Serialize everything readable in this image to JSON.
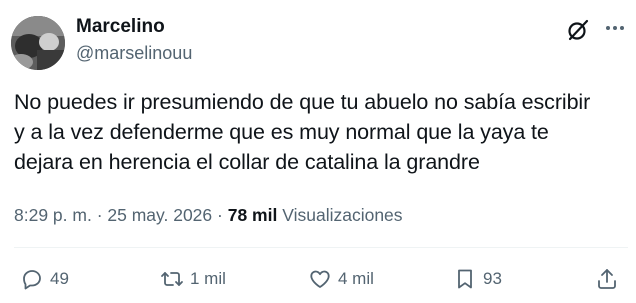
{
  "author": {
    "name": "Marcelino",
    "handle": "@marselinouu"
  },
  "tweet": {
    "lines": [
      "No puedes ir presumiendo de que tu abuelo no sabía escribir",
      "y a la vez defenderme que es muy normal que la yaya te",
      "dejara en herencia el collar de catalina la grandre"
    ]
  },
  "meta": {
    "time": "8:29 p. m.",
    "separator": "·",
    "date": "25 may. 2026",
    "views_count": "78 mil",
    "views_label": "Visualizaciones"
  },
  "actions": {
    "replies": "49",
    "reposts": "1 mil",
    "likes": "4 mil",
    "bookmarks": "93"
  },
  "icons": {
    "grok": "grok-icon",
    "more": "more-options-icon",
    "reply": "reply-icon",
    "repost": "repost-icon",
    "like": "heart-icon",
    "bookmark": "bookmark-icon",
    "share": "share-icon"
  },
  "colors": {
    "text": "#0f1419",
    "secondary": "#536471",
    "divider": "#eff3f4"
  }
}
